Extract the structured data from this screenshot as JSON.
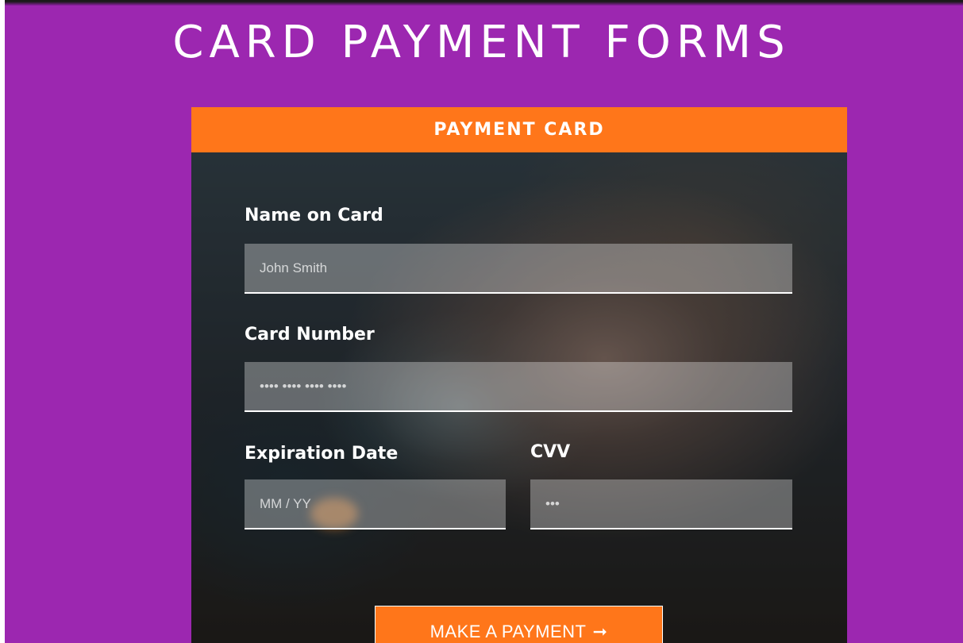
{
  "page": {
    "title": "CARD PAYMENT FORMS"
  },
  "card": {
    "header": "PAYMENT CARD",
    "fields": {
      "name": {
        "label": "Name on Card",
        "placeholder": "John Smith"
      },
      "number": {
        "label": "Card Number",
        "placeholder": "•••• •••• •••• ••••"
      },
      "expiry": {
        "label": "Expiration Date",
        "placeholder": "MM / YY"
      },
      "cvv": {
        "label": "CVV",
        "placeholder": "•••"
      }
    },
    "submit": {
      "label": "MAKE A PAYMENT",
      "icon": "arrow-right-icon",
      "icon_glyph": "➞"
    }
  },
  "colors": {
    "background": "#9c27b0",
    "accent": "#ff761a",
    "text": "#ffffff"
  }
}
